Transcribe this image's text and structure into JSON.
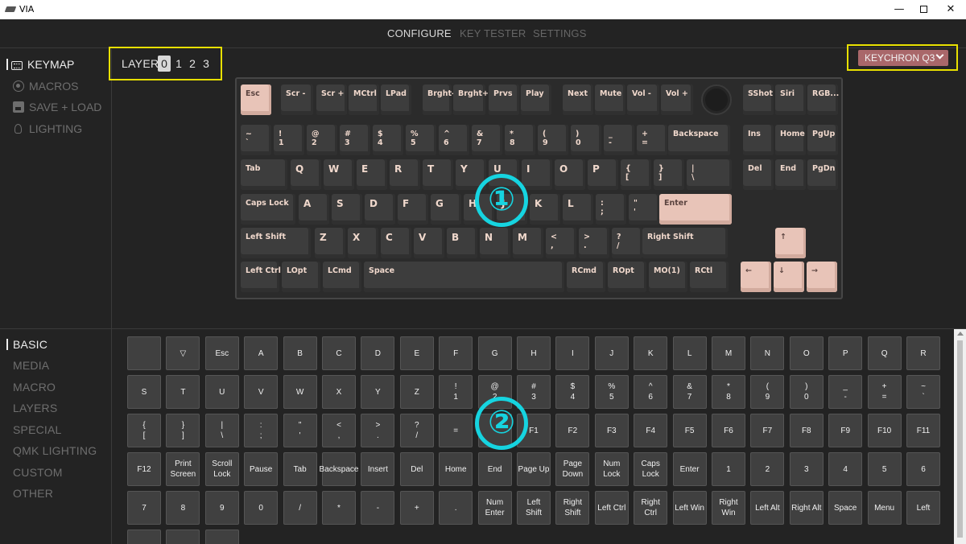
{
  "window": {
    "title": "VIA",
    "minimize": "—",
    "close": "✕"
  },
  "nav": {
    "configure": "CONFIGURE",
    "key_tester": "KEY TESTER",
    "settings": "SETTINGS"
  },
  "sidebar": {
    "keymap": "KEYMAP",
    "macros": "MACROS",
    "save_load": "SAVE + LOAD",
    "lighting": "LIGHTING"
  },
  "layers": {
    "label": "LAYER",
    "items": [
      "0",
      "1",
      "2",
      "3"
    ],
    "selected": "0"
  },
  "keyboard_select": {
    "value": "KEYCHRON Q3"
  },
  "annotations": {
    "one": "①",
    "two": "②"
  },
  "keyboard": {
    "row0": [
      "Esc",
      "Scr -",
      "Scr +",
      "MCtrl",
      "LPad",
      "Brght-",
      "Brght+",
      "Prvs",
      "Play",
      "Next",
      "Mute",
      "Vol -",
      "Vol +",
      "SShot",
      "Siri",
      "RGB..."
    ],
    "row1": [
      "~\n`",
      "!\n1",
      "@\n2",
      "#\n3",
      "$\n4",
      "%\n5",
      "^\n6",
      "&\n7",
      "*\n8",
      "(\n9",
      ")\n0",
      "_\n-",
      "+\n=",
      "Backspace",
      "Ins",
      "Home",
      "PgUp"
    ],
    "row2": [
      "Tab",
      "Q",
      "W",
      "E",
      "R",
      "T",
      "Y",
      "U",
      "I",
      "O",
      "P",
      "{\n[",
      "}\n]",
      "|\n\\",
      "Del",
      "End",
      "PgDn"
    ],
    "row3": [
      "Caps Lock",
      "A",
      "S",
      "D",
      "F",
      "G",
      "H",
      "J",
      "K",
      "L",
      ":\n;",
      "\"\n'",
      "Enter"
    ],
    "row4": [
      "Left Shift",
      "Z",
      "X",
      "C",
      "V",
      "B",
      "N",
      "M",
      "<\n,",
      ">\n.",
      "?\n/",
      "Right Shift",
      "↑"
    ],
    "row5": [
      "Left Ctrl",
      "LOpt",
      "LCmd",
      "Space",
      "RCmd",
      "ROpt",
      "MO(1)",
      "RCtl",
      "←",
      "↓",
      "→"
    ]
  },
  "categories": [
    "BASIC",
    "MEDIA",
    "MACRO",
    "LAYERS",
    "SPECIAL",
    "QMK LIGHTING",
    "CUSTOM",
    "OTHER"
  ],
  "palette": [
    [
      "",
      "▽",
      "Esc",
      "A",
      "B",
      "C",
      "D",
      "E",
      "F",
      "G",
      "H",
      "I",
      "J",
      "K",
      "L",
      "M",
      "N",
      "O",
      "P",
      "Q",
      "R"
    ],
    [
      "S",
      "T",
      "U",
      "V",
      "W",
      "X",
      "Y",
      "Z",
      "!\n1",
      "@\n2",
      "#\n3",
      "$\n4",
      "%\n5",
      "^\n6",
      "&\n7",
      "*\n8",
      "(\n9",
      ")\n0",
      "_\n-",
      "+\n=",
      "~\n`"
    ],
    [
      "{\n[",
      "}\n]",
      "|\n\\",
      ":\n;",
      "\"\n'",
      "<\n,",
      ">\n.",
      "?\n/",
      "=",
      "",
      "F1",
      "F2",
      "F3",
      "F4",
      "F5",
      "F6",
      "F7",
      "F8",
      "F9",
      "F10",
      "F11"
    ],
    [
      "F12",
      "Print\nScreen",
      "Scroll\nLock",
      "Pause",
      "Tab",
      "Backspace",
      "Insert",
      "Del",
      "Home",
      "End",
      "Page Up",
      "Page\nDown",
      "Num\nLock",
      "Caps\nLock",
      "Enter",
      "1",
      "2",
      "3",
      "4",
      "5",
      "6"
    ],
    [
      "7",
      "8",
      "9",
      "0",
      "/",
      "*",
      "-",
      "+",
      ".",
      "Num\nEnter",
      "Left\nShift",
      "Right\nShift",
      "Left Ctrl",
      "Right\nCtrl",
      "Left Win",
      "Right\nWin",
      "Left Alt",
      "Right Alt",
      "Space",
      "Menu",
      "Left"
    ],
    [
      "",
      "",
      ""
    ]
  ],
  "colors": {
    "accent": "#e8c4b8",
    "annotation": "#16d4e0",
    "highlight": "#e8e000",
    "keyboard_select": "#a9676a"
  }
}
